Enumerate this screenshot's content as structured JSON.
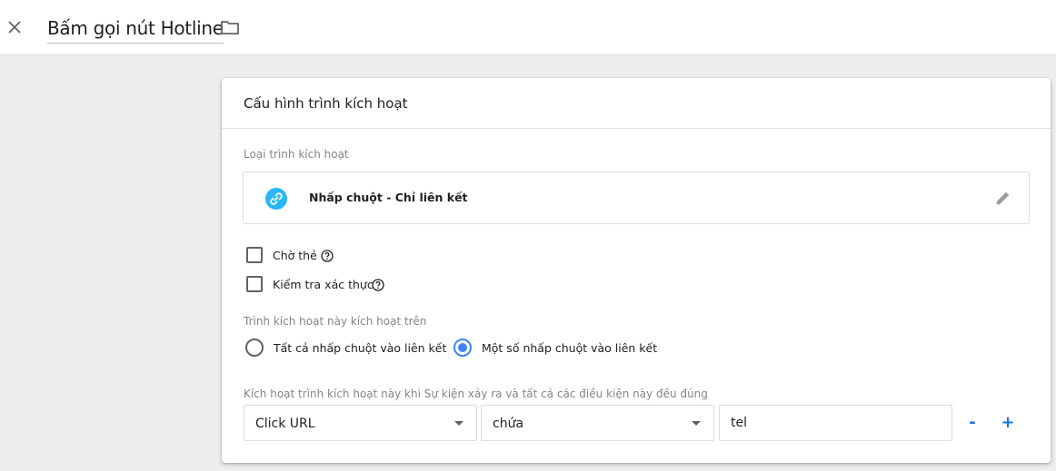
{
  "header": {
    "title": "Bấm gọi nút Hotline",
    "close_icon": "close-icon",
    "folder_icon": "folder-icon"
  },
  "card": {
    "title": "Cấu hình trình kích hoạt",
    "trigger_type_label": "Loại trình kích hoạt",
    "trigger_type": {
      "name": "Nhấp chuột - Chỉ liên kết",
      "icon": "link-icon",
      "icon_color": "#29b6f6",
      "edit_icon": "pencil-icon"
    },
    "options": {
      "wait_for_tags": {
        "label": "Chờ thẻ",
        "checked": false
      },
      "check_validation": {
        "label": "Kiểm tra xác thực",
        "checked": false
      }
    },
    "fires_on": {
      "label": "Trình kích hoạt này kích hoạt trên",
      "all_clicks": {
        "label": "Tất cả nhấp chuột vào liên kết",
        "selected": false
      },
      "some_clicks": {
        "label": "Một số nhấp chuột vào liên kết",
        "selected": true
      }
    },
    "condition": {
      "label": "Kích hoạt trình kích hoạt này khi Sự kiện xảy ra và tất cả các điều kiện này đều đúng",
      "variable": "Click URL",
      "operator": "chứa",
      "value": "tel",
      "remove_label": "-",
      "add_label": "+"
    }
  },
  "colors": {
    "accent": "#4285f4",
    "link_button": "#1a73e8"
  }
}
